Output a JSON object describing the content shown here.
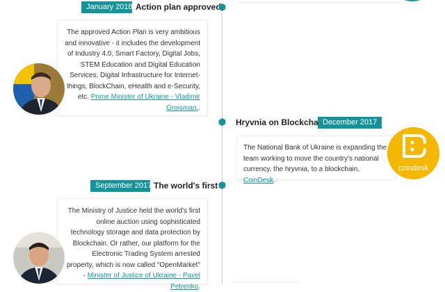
{
  "colors": {
    "accent": "#15939a",
    "line": "#c8c8c8",
    "logo_bg": "#f5b800"
  },
  "events": [
    {
      "date": "January 2018",
      "title": "Action plan approved",
      "text": "The approved Action Plan is very ambitious and innovative - it includes the development of Industry 4.0, Smart Factory, Digital Jobs, STEM Education and Digital Education Services, Digital Infrastructure for Internet-things, BlockChain, eHealth and e-Security, etc.",
      "source_link": "Prime Minister of Ukraine - Vladimir Groisman.",
      "suffix": ".",
      "avatar_icon": "person-portrait-icon"
    },
    {
      "date": "December 2017",
      "title": "Hryvnia on Blockchain",
      "text": "The National Bank of Ukraine is expanding the team working to move the country's national currency, the hryvnia, to a blockchain,",
      "source_link": "CoinDesk",
      "suffix": ".",
      "logo_text": "coindesk",
      "logo_icon": "coindesk-logo-icon"
    },
    {
      "date": "September 2017",
      "title": "The world's first",
      "text": "The Ministry of Justice held the world's first online auction using sophisticated technology storage and data protection by Blockchain. Or rather, our platform for the Electronic Trading System arrested property, which is now called \"OpenMarket\" -",
      "source_link": "Minister of Justice of Ukraine - Pavel Petrenko",
      "suffix": ".",
      "avatar_icon": "person-portrait-icon"
    }
  ]
}
